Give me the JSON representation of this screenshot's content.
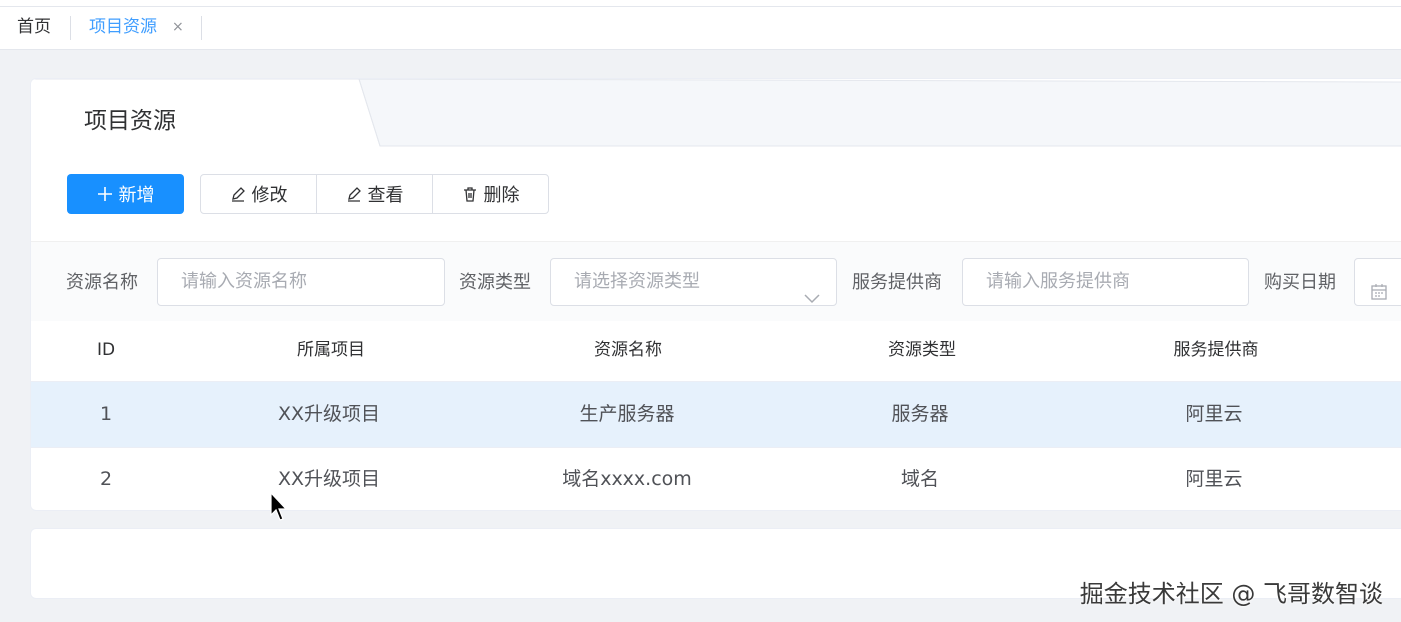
{
  "tabs": {
    "home": "首页",
    "active": "项目资源",
    "close": "×"
  },
  "card": {
    "tab_label": "项目资源"
  },
  "toolbar": {
    "add_label": "新增",
    "edit_label": "修改",
    "view_label": "查看",
    "delete_label": "删除"
  },
  "filters": {
    "name_label": "资源名称",
    "name_placeholder": "请输入资源名称",
    "type_label": "资源类型",
    "type_placeholder": "请选择资源类型",
    "provider_label": "服务提供商",
    "provider_placeholder": "请输入服务提供商",
    "date_label": "购买日期"
  },
  "table": {
    "headers": [
      "ID",
      "所属项目",
      "资源名称",
      "资源类型",
      "服务提供商"
    ],
    "rows": [
      [
        "1",
        "XX升级项目",
        "生产服务器",
        "服务器",
        "阿里云"
      ],
      [
        "2",
        "XX升级项目",
        "域名xxxx.com",
        "域名",
        "阿里云"
      ]
    ]
  },
  "watermark": "掘金技术社区 @ 飞哥数智谈",
  "colors": {
    "primary": "#1890ff",
    "active_tab": "#409eff",
    "row_highlight": "#e6f1fc"
  },
  "icons": {
    "add": "plus-icon",
    "edit": "edit-icon",
    "view": "edit-icon",
    "delete": "trash-icon",
    "select": "chevron-down-icon",
    "date": "calendar-icon"
  }
}
